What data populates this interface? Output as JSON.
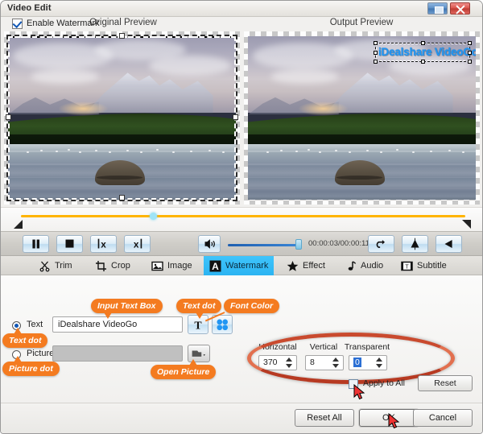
{
  "window": {
    "title": "Video Edit",
    "restore_icon": "restore-icon",
    "close_icon": "close-icon"
  },
  "previews": {
    "original_label": "Original Preview",
    "output_label": "Output Preview",
    "watermark_overlay_text": "iDealshare VideoGo"
  },
  "timeline": {
    "playhead_position_pct": 29
  },
  "controls": {
    "pause": "pause-icon",
    "stop": "stop-icon",
    "mark_in": "mark-in-icon",
    "mark_out": "mark-out-icon",
    "volume": "volume-icon",
    "time_display": "00:00:03/00:00:11",
    "undo": "undo-icon",
    "flip_vertical": "flip-vertical-icon",
    "flip_horizontal": "flip-horizontal-icon"
  },
  "tabs": [
    {
      "label": "Trim",
      "icon": "scissors-icon",
      "active": false
    },
    {
      "label": "Crop",
      "icon": "crop-icon",
      "active": false
    },
    {
      "label": "Image",
      "icon": "image-icon",
      "active": false
    },
    {
      "label": "Watermark",
      "icon": "letter-a-icon",
      "active": true
    },
    {
      "label": "Effect",
      "icon": "star-icon",
      "active": false
    },
    {
      "label": "Audio",
      "icon": "note-icon",
      "active": false
    },
    {
      "label": "Subtitle",
      "icon": "subtitle-icon",
      "active": false
    }
  ],
  "watermark_panel": {
    "enable_label": "Enable Watermark",
    "enable_checked": true,
    "text_radio_label": "Text",
    "text_radio_selected": true,
    "text_value": "iDealshare VideoGo",
    "picture_radio_label": "Picture",
    "picture_radio_selected": false,
    "picture_value": "",
    "font_button_icon": "text-format-icon",
    "color_button_icon": "color-palette-icon",
    "open_picture_icon": "folder-open-icon",
    "spinners": [
      {
        "label": "Horizontal",
        "value": "370",
        "selected": false
      },
      {
        "label": "Vertical",
        "value": "8",
        "selected": false
      },
      {
        "label": "Transparent",
        "value": "0",
        "selected": true
      }
    ],
    "apply_to_all_label": "Apply to All",
    "apply_to_all_checked": false,
    "reset_label": "Reset"
  },
  "footer": {
    "reset_all_label": "Reset All",
    "ok_label": "OK",
    "cancel_label": "Cancel"
  },
  "annotations": [
    {
      "id": "input-text-box",
      "text": "Input Text Box"
    },
    {
      "id": "text-dot-top",
      "text": "Text dot"
    },
    {
      "id": "font-color",
      "text": "Font Color"
    },
    {
      "id": "text-dot",
      "text": "Text dot"
    },
    {
      "id": "picture-dot",
      "text": "Picture dot"
    },
    {
      "id": "open-picture",
      "text": "Open Picture"
    }
  ],
  "colors": {
    "accent_orange": "#f47b20",
    "tab_active_blue": "#2bb4f2",
    "watermark_blue": "#2196f3",
    "timeline_yellow": "#ffb400",
    "highlight_ellipse": "#d9482c"
  }
}
